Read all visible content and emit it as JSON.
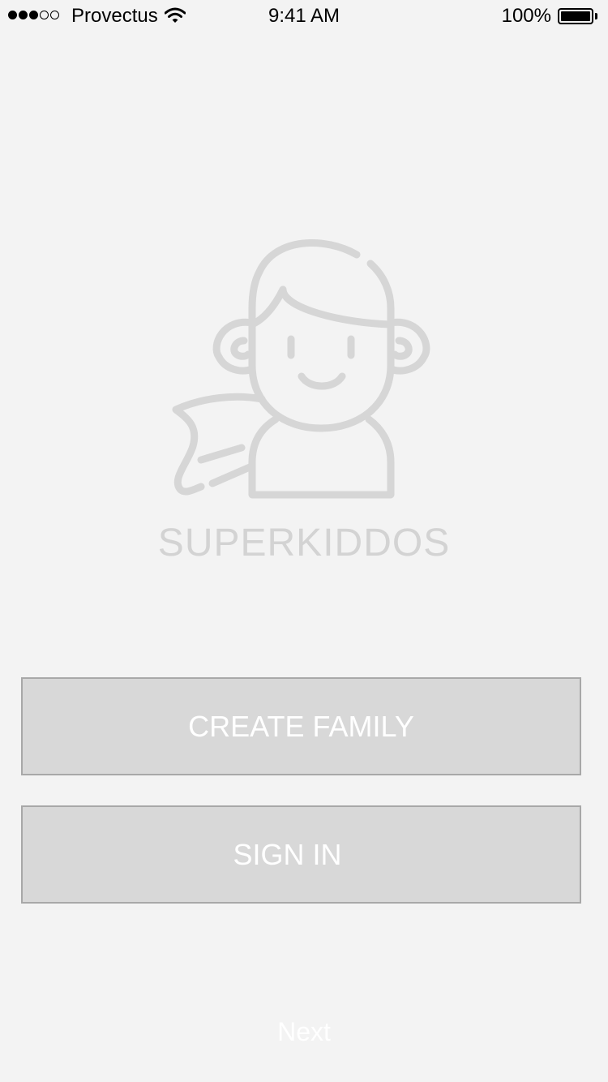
{
  "status_bar": {
    "signal_bars_filled": 3,
    "signal_bars_total": 5,
    "carrier": "Provectus",
    "wifi_icon": "wifi-icon",
    "time": "9:41 AM",
    "battery_percent": "100%",
    "battery_level": 1.0
  },
  "logo": {
    "icon": "superhero-kid-icon",
    "brand_name": "SUPERKIDDOS",
    "color": "#d6d6d6"
  },
  "actions": {
    "create_family_label": "CREATE FAMILY",
    "sign_in_label": "SIGN IN",
    "button_background": "#d8d8d8",
    "button_text_color": "#ffffff"
  },
  "footer": {
    "next_label": "Next"
  },
  "colors": {
    "background": "#f3f3f3"
  }
}
